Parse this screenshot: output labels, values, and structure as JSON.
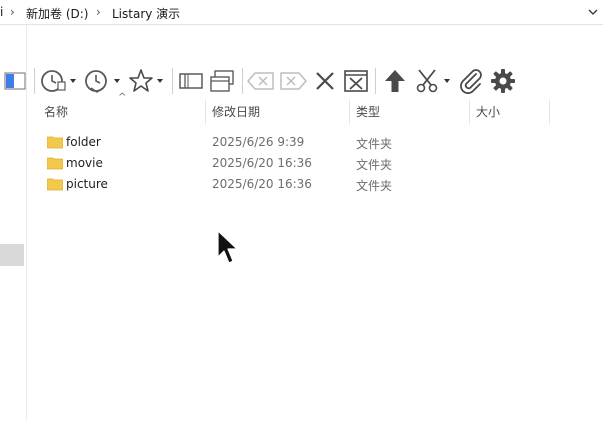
{
  "address_bar": {
    "leading_fragment": "i",
    "crumbs": [
      "新加卷 (D:)",
      "Listary 演示"
    ],
    "separator": "›",
    "dropdown": "chevron-down-icon"
  },
  "toolbar": {
    "icons": [
      "panel-layout-icon",
      "recent-history-icon",
      "history-clock-icon",
      "favorites-star-icon",
      "view-panels-icon",
      "windows-icon",
      "backspace-left-icon",
      "backspace-right-icon",
      "close-x-icon",
      "close-window-icon",
      "arrow-up-icon",
      "scissors-icon",
      "paperclip-icon",
      "gear-icon"
    ]
  },
  "columns": {
    "name": "名称",
    "date": "修改日期",
    "type": "类型",
    "size": "大小"
  },
  "sort_indicator": "^",
  "files": [
    {
      "name": "folder",
      "date": "2025/6/26 9:39",
      "type": "文件夹"
    },
    {
      "name": "movie",
      "date": "2025/6/20 16:36",
      "type": "文件夹"
    },
    {
      "name": "picture",
      "date": "2025/6/20 16:36",
      "type": "文件夹"
    }
  ],
  "colors": {
    "folder": "#f2c94c",
    "folder_dark": "#e0ac2e",
    "panel_blue": "#3f7ee8",
    "icon": "#5a5a5a"
  }
}
